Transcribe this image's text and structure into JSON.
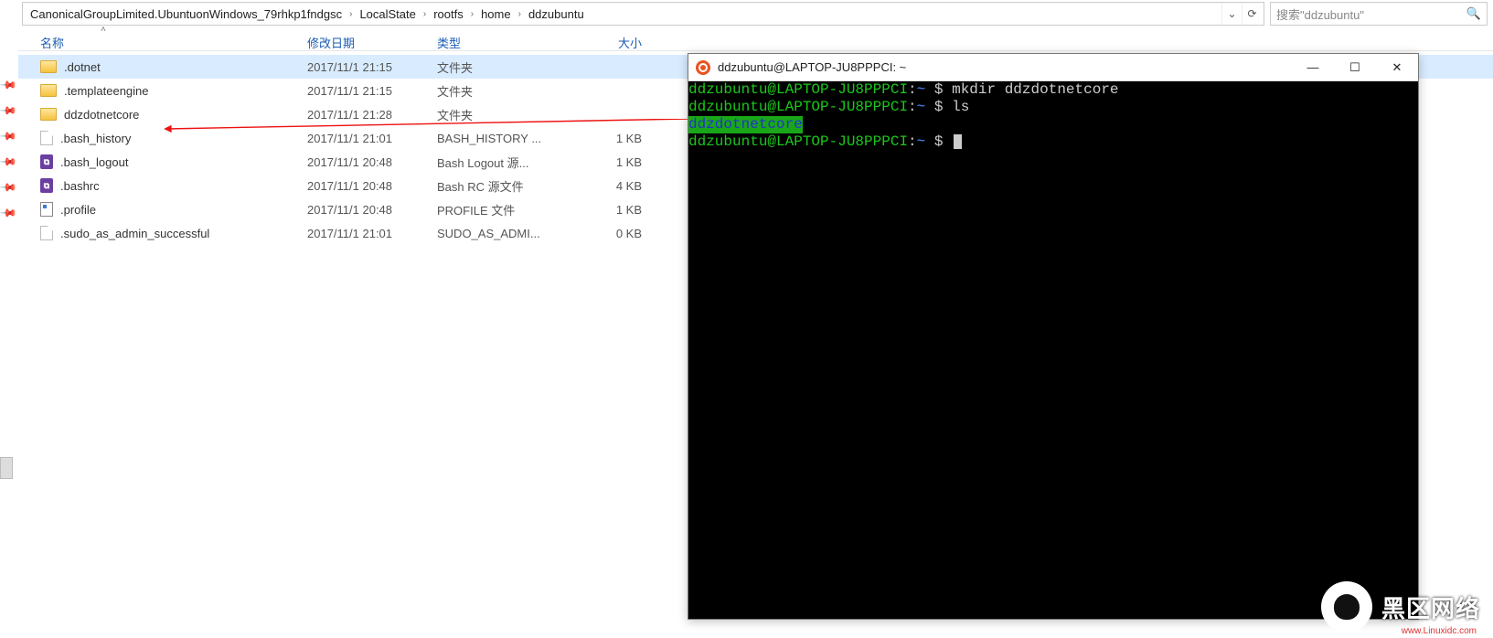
{
  "breadcrumbs": [
    "CanonicalGroupLimited.UbuntuonWindows_79rhkp1fndgsc",
    "LocalState",
    "rootfs",
    "home",
    "ddzubuntu"
  ],
  "search": {
    "placeholder": "搜索\"ddzubuntu\""
  },
  "columns": {
    "name": "名称",
    "date": "修改日期",
    "type": "类型",
    "size": "大小"
  },
  "files": [
    {
      "icon": "folder",
      "name": ".dotnet",
      "date": "2017/11/1 21:15",
      "type": "文件夹",
      "size": "",
      "selected": true
    },
    {
      "icon": "folder",
      "name": ".templateengine",
      "date": "2017/11/1 21:15",
      "type": "文件夹",
      "size": ""
    },
    {
      "icon": "folder",
      "name": "ddzdotnetcore",
      "date": "2017/11/1 21:28",
      "type": "文件夹",
      "size": ""
    },
    {
      "icon": "file",
      "name": ".bash_history",
      "date": "2017/11/1 21:01",
      "type": "BASH_HISTORY ...",
      "size": "1 KB"
    },
    {
      "icon": "code",
      "name": ".bash_logout",
      "date": "2017/11/1 20:48",
      "type": "Bash Logout 源...",
      "size": "1 KB"
    },
    {
      "icon": "code",
      "name": ".bashrc",
      "date": "2017/11/1 20:48",
      "type": "Bash RC 源文件",
      "size": "4 KB"
    },
    {
      "icon": "ini",
      "name": ".profile",
      "date": "2017/11/1 20:48",
      "type": "PROFILE 文件",
      "size": "1 KB"
    },
    {
      "icon": "file",
      "name": ".sudo_as_admin_successful",
      "date": "2017/11/1 21:01",
      "type": "SUDO_AS_ADMI...",
      "size": "0 KB"
    }
  ],
  "terminal": {
    "title": "ddzubuntu@LAPTOP-JU8PPPCI: ~",
    "user_host": "ddzubuntu@LAPTOP-JU8PPPCI",
    "path": "~",
    "dollar": "$",
    "cmd1": "mkdir ddzdotnetcore",
    "cmd2": "ls",
    "ls_out": "ddzdotnetcore",
    "win_min": "—",
    "win_max": "☐",
    "win_close": "✕"
  },
  "watermark": {
    "text": "黑区网络",
    "sub": "www.Linuxidc.com"
  }
}
